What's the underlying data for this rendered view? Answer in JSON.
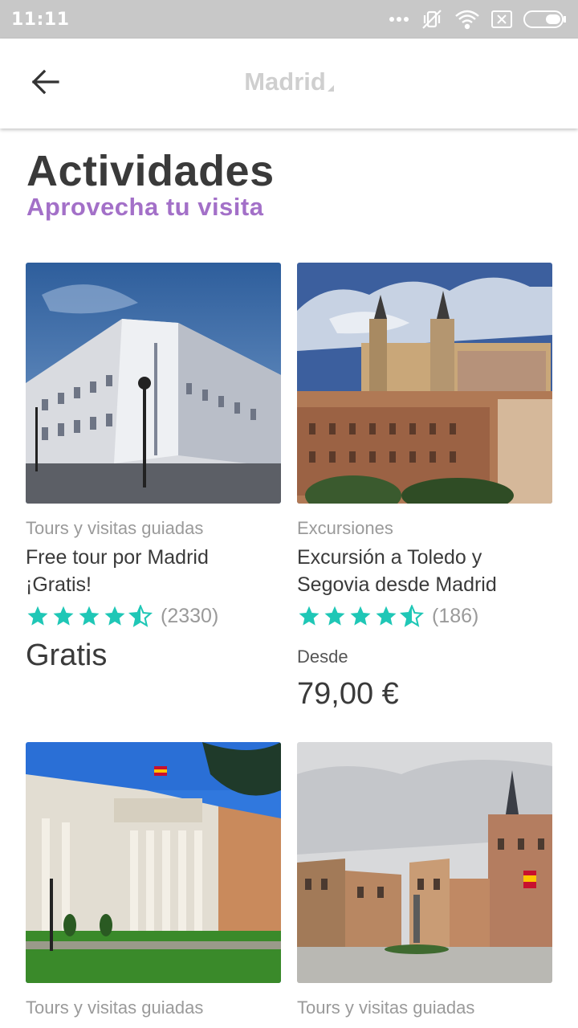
{
  "status_bar": {
    "time": "11:11"
  },
  "header": {
    "city": "Madrid"
  },
  "section": {
    "title": "Actividades",
    "subtitle": "Aprovecha tu visita"
  },
  "colors": {
    "accent": "#a370c8",
    "star": "#1fc7b6",
    "muted": "#9a9a9a"
  },
  "cards": [
    {
      "category": "Tours y visitas guiadas",
      "title_line1": "Free tour por Madrid",
      "title_line2": "¡Gratis!",
      "rating": 4.5,
      "reviews": "(2330)",
      "price": "Gratis",
      "image": "royal-palace-photo"
    },
    {
      "category": "Excursiones",
      "title_line1": "Excursión a Toledo y",
      "title_line2": "Segovia desde Madrid",
      "rating": 4.5,
      "reviews": "(186)",
      "price_prefix": "Desde",
      "price": "79,00 €",
      "image": "toledo-photo"
    },
    {
      "category": "Tours y visitas guiadas",
      "image": "prado-museum-photo"
    },
    {
      "category": "Tours y visitas guiadas",
      "image": "plaza-de-la-villa-photo"
    }
  ]
}
